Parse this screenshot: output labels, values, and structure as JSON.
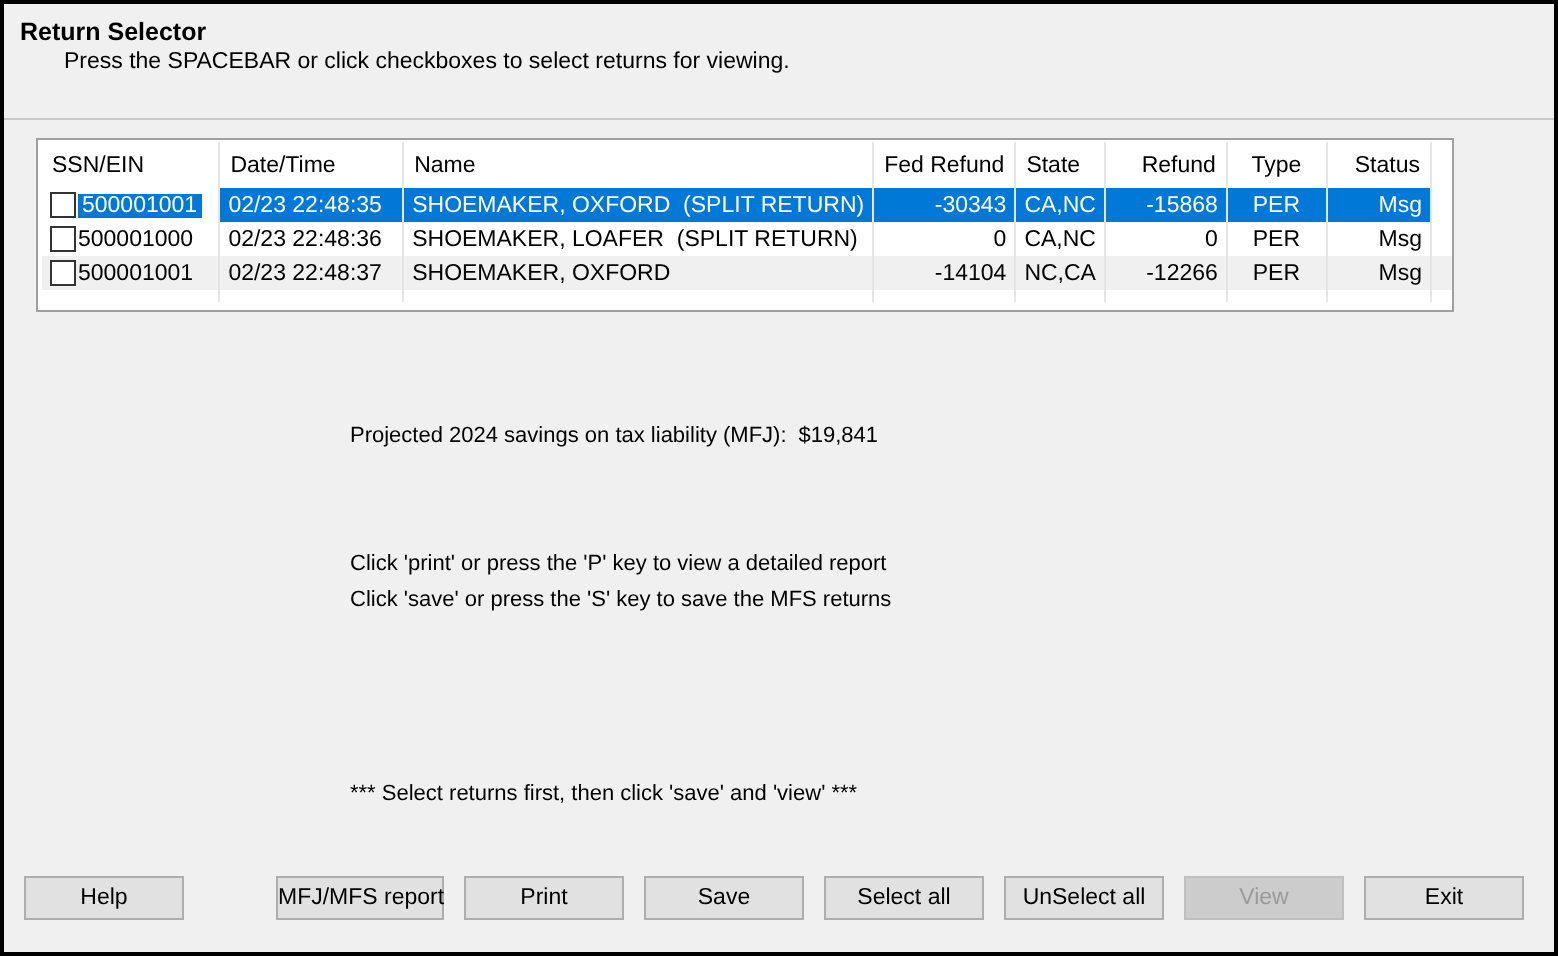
{
  "header": {
    "title": "Return Selector",
    "subtitle": "Press the SPACEBAR or click checkboxes to select returns for viewing."
  },
  "table": {
    "columns": [
      "SSN/EIN",
      "Date/Time",
      "Name",
      "Fed Refund",
      "State",
      "Refund",
      "Type",
      "Status"
    ],
    "rows": [
      {
        "checked": false,
        "selected": true,
        "cells": [
          "500001001",
          "02/23 22:48:35",
          "SHOEMAKER, OXFORD  (SPLIT RETURN)",
          "-30343",
          "CA,NC",
          "-15868",
          "PER",
          "Msg"
        ]
      },
      {
        "checked": false,
        "selected": false,
        "cells": [
          "500001000",
          "02/23 22:48:36",
          "SHOEMAKER, LOAFER  (SPLIT RETURN)",
          "0",
          "CA,NC",
          "0",
          "PER",
          "Msg"
        ]
      },
      {
        "checked": false,
        "selected": false,
        "cells": [
          "500001001",
          "02/23 22:48:37",
          "SHOEMAKER, OXFORD",
          "-14104",
          "NC,CA",
          "-12266",
          "PER",
          "Msg"
        ]
      }
    ]
  },
  "savings": {
    "label": "Projected 2024 savings on tax liability (MFJ):",
    "value": "$19,841"
  },
  "instructions": [
    "Click 'print' or press the 'P' key to view a detailed report",
    "Click 'save' or press the 'S' key to save the MFS returns"
  ],
  "note": "*** Select returns first, then click 'save' and 'view' ***",
  "buttons": [
    {
      "label": "Help",
      "disabled": false
    },
    {
      "label": "MFJ/MFS report",
      "disabled": false
    },
    {
      "label": "Print",
      "disabled": false
    },
    {
      "label": "Save",
      "disabled": false
    },
    {
      "label": "Select all",
      "disabled": false
    },
    {
      "label": "UnSelect all",
      "disabled": false
    },
    {
      "label": "View",
      "disabled": true
    },
    {
      "label": "Exit",
      "disabled": false
    }
  ]
}
